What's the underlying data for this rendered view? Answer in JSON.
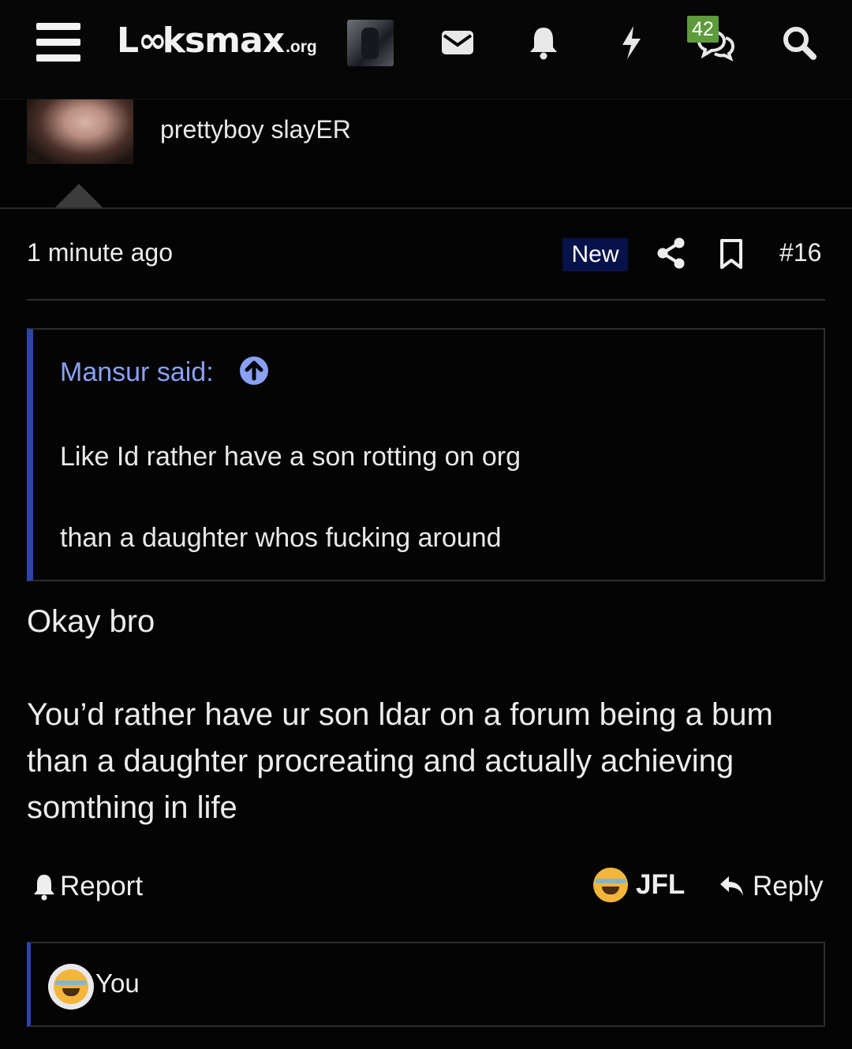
{
  "nav": {
    "logo_main": "Lookmax",
    "logo_tld": ".org",
    "icons": [
      "menu-icon",
      "mail-icon",
      "bell-icon",
      "lightning-icon",
      "chat-icon",
      "search-icon"
    ],
    "chat_badge": "42"
  },
  "author": {
    "name": "prettyboy slayER"
  },
  "post": {
    "time": "1 minute ago",
    "new_label": "New",
    "number": "#16",
    "quote": {
      "author": "Mansur said:",
      "lines": [
        "Like Id rather have a son rotting on org",
        "than a daughter whos fucking around"
      ]
    },
    "body": {
      "line1": "Okay bro",
      "paragraph": [
        "You’d rather have ur son ldar on a forum being a bum",
        "than a daughter procreating and actually achieving",
        "somthing in life"
      ]
    }
  },
  "actions": {
    "report_label": "Report",
    "reaction_label": "JFL",
    "reply_label": "Reply"
  },
  "reactions": {
    "user": "You"
  },
  "colors": {
    "background": "#040404",
    "accent_blue": "#2f43a8",
    "quote_author": "#8aa0f3",
    "new_badge": "#07124a",
    "chat_badge": "#5e9b3c"
  }
}
